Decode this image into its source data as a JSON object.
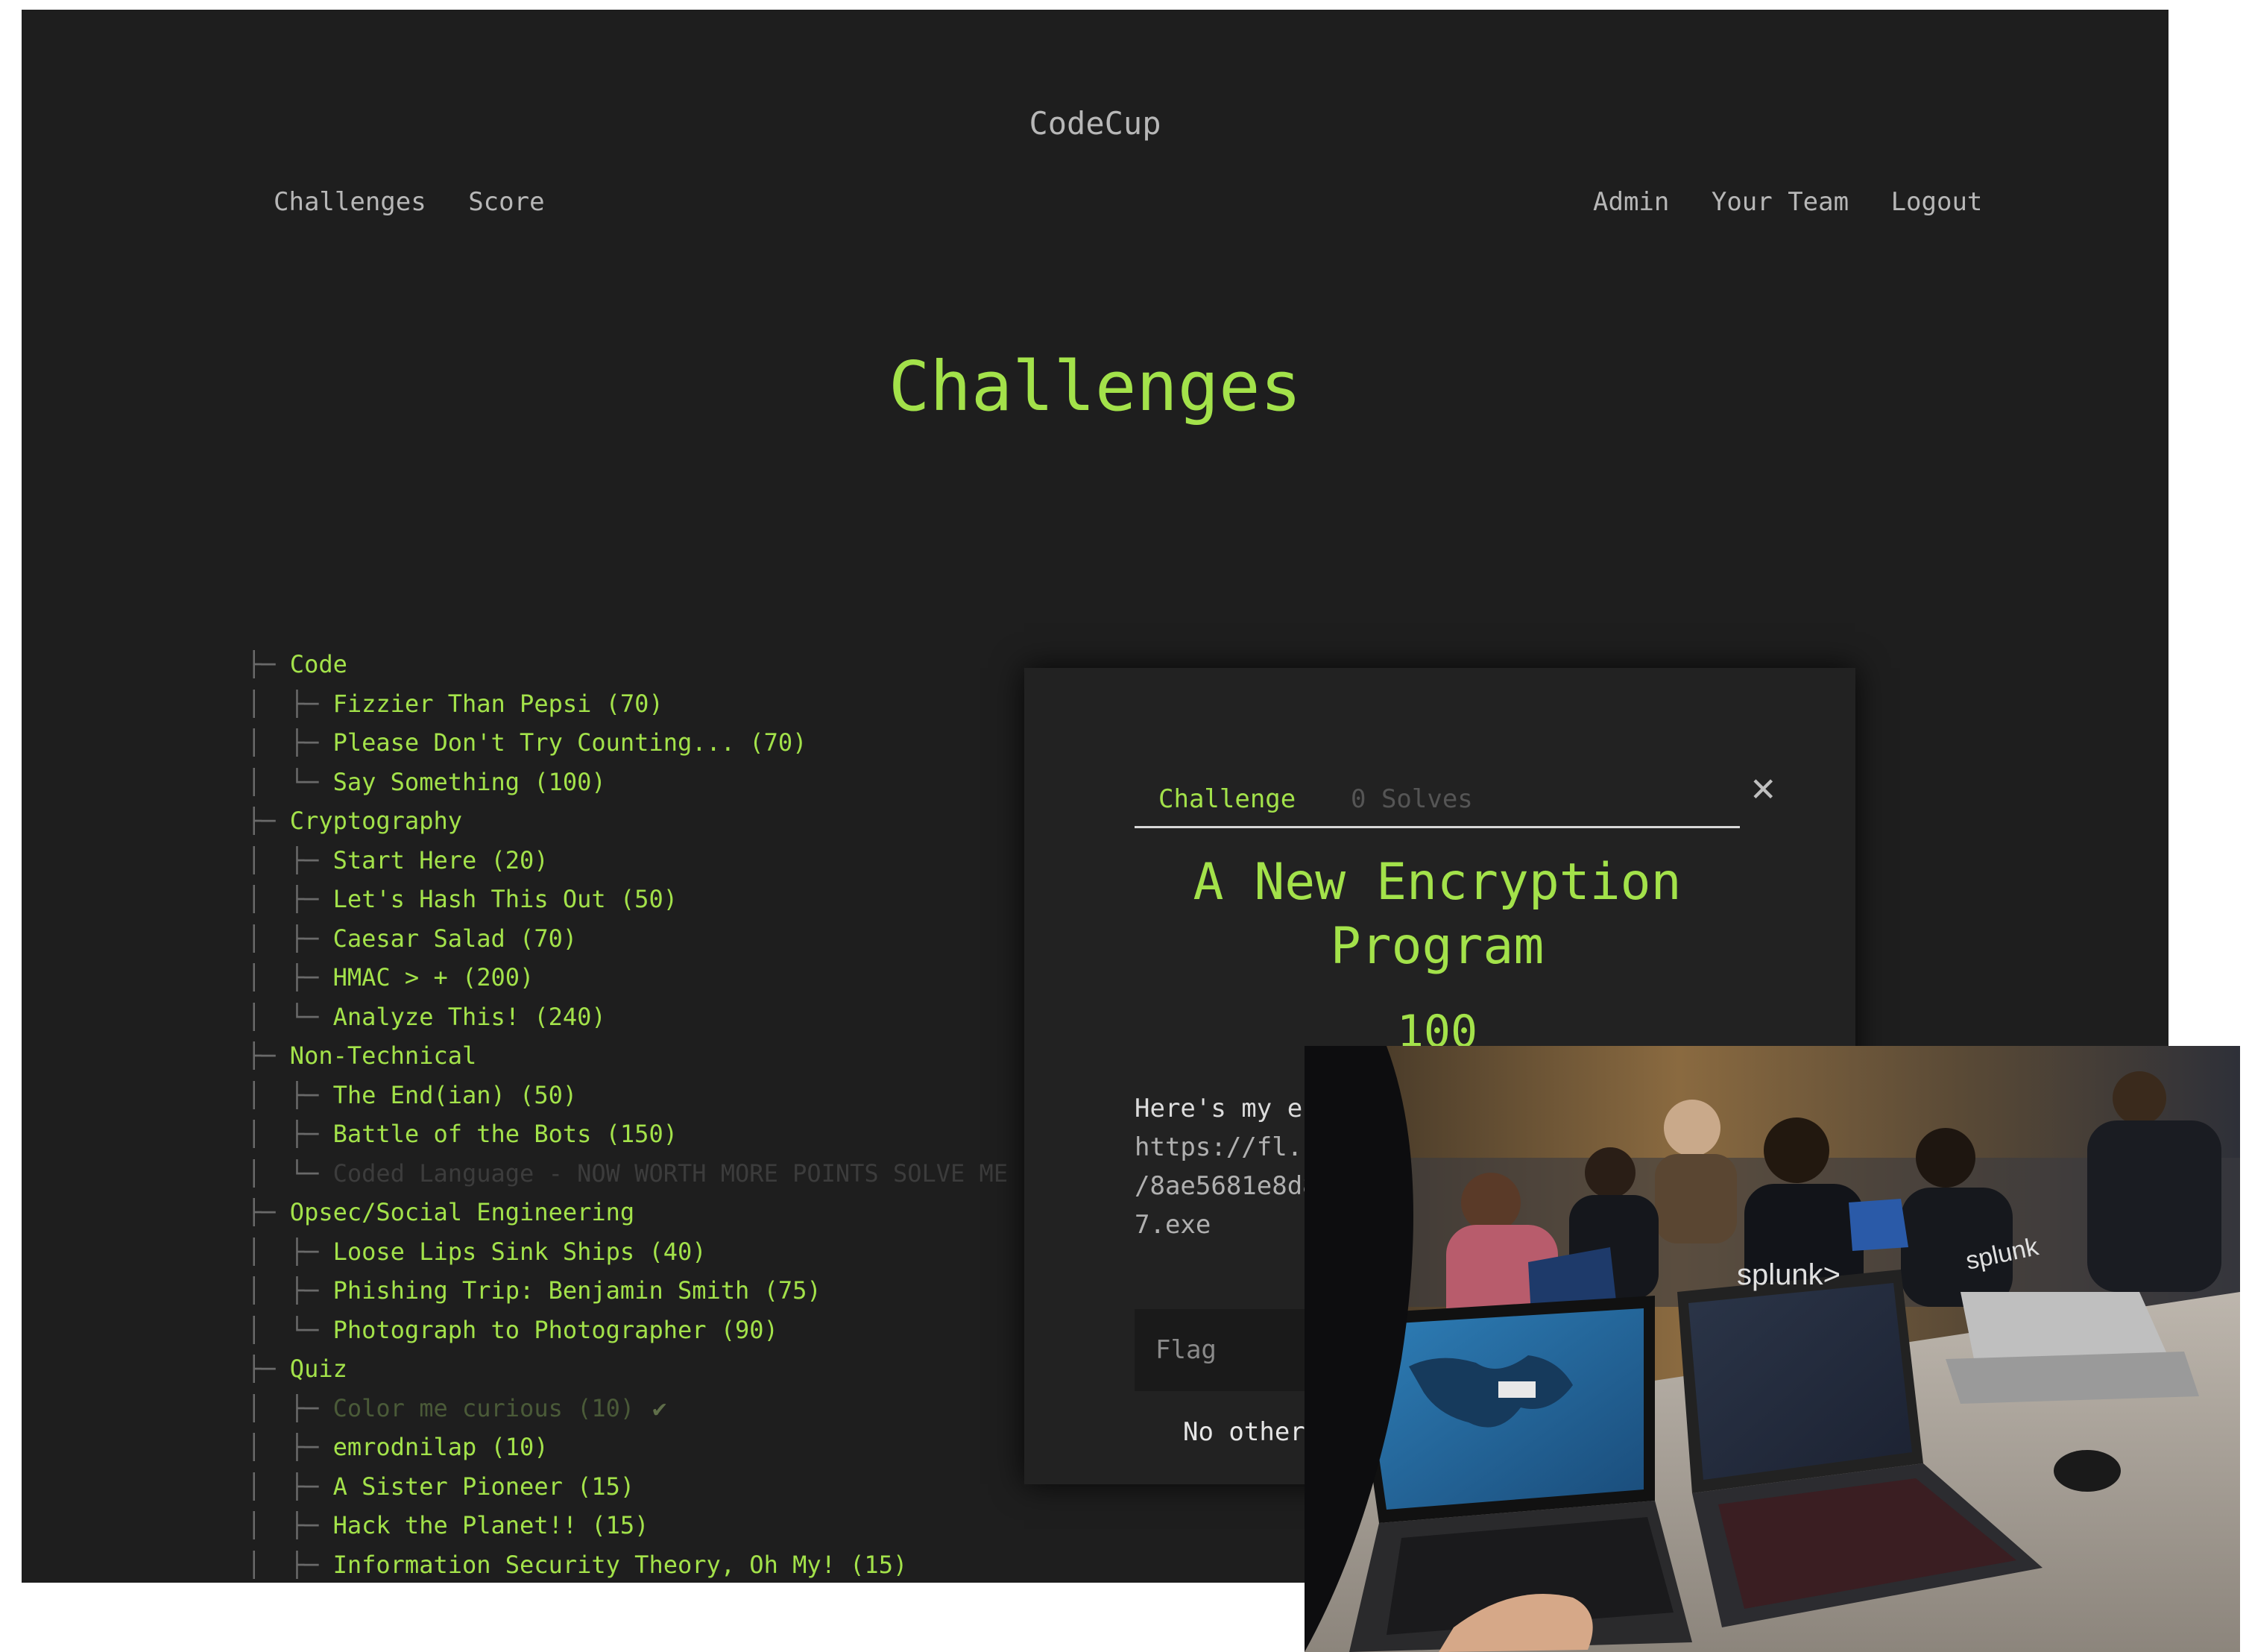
{
  "brand": "CodeCup",
  "nav": {
    "left": [
      "Challenges",
      "Score"
    ],
    "right": [
      "Admin",
      "Your Team",
      "Logout"
    ]
  },
  "page_title": "Challenges",
  "tree": [
    {
      "label": "Code",
      "depth": 0,
      "last": false,
      "state": "normal"
    },
    {
      "label": "Fizzier Than Pepsi (70)",
      "depth": 1,
      "last": false,
      "state": "normal"
    },
    {
      "label": "Please Don't Try Counting... (70)",
      "depth": 1,
      "last": false,
      "state": "normal"
    },
    {
      "label": "Say Something (100)",
      "depth": 1,
      "last": true,
      "state": "normal"
    },
    {
      "label": "Cryptography",
      "depth": 0,
      "last": false,
      "state": "normal"
    },
    {
      "label": "Start Here (20)",
      "depth": 1,
      "last": false,
      "state": "normal"
    },
    {
      "label": "Let's Hash This Out (50)",
      "depth": 1,
      "last": false,
      "state": "normal"
    },
    {
      "label": "Caesar Salad (70)",
      "depth": 1,
      "last": false,
      "state": "normal"
    },
    {
      "label": "HMAC > + (200)",
      "depth": 1,
      "last": false,
      "state": "normal"
    },
    {
      "label": "Analyze This! (240)",
      "depth": 1,
      "last": true,
      "state": "normal"
    },
    {
      "label": "Non-Technical",
      "depth": 0,
      "last": false,
      "state": "normal"
    },
    {
      "label": "The End(ian) (50)",
      "depth": 1,
      "last": false,
      "state": "normal"
    },
    {
      "label": "Battle of the Bots (150)",
      "depth": 1,
      "last": false,
      "state": "normal"
    },
    {
      "label": "Coded Language - NOW WORTH MORE POINTS SOLVE ME",
      "depth": 1,
      "last": true,
      "state": "dimmed"
    },
    {
      "label": "Opsec/Social Engineering",
      "depth": 0,
      "last": false,
      "state": "normal"
    },
    {
      "label": "Loose Lips Sink Ships (40)",
      "depth": 1,
      "last": false,
      "state": "normal"
    },
    {
      "label": "Phishing Trip: Benjamin Smith (75)",
      "depth": 1,
      "last": false,
      "state": "normal"
    },
    {
      "label": "Photograph to Photographer (90)",
      "depth": 1,
      "last": true,
      "state": "normal"
    },
    {
      "label": "Quiz",
      "depth": 0,
      "last": false,
      "state": "normal"
    },
    {
      "label": "Color me curious (10)",
      "depth": 1,
      "last": false,
      "state": "solved"
    },
    {
      "label": "emrodnilap (10)",
      "depth": 1,
      "last": false,
      "state": "normal"
    },
    {
      "label": "A Sister Pioneer (15)",
      "depth": 1,
      "last": false,
      "state": "normal"
    },
    {
      "label": "Hack the Planet!! (15)",
      "depth": 1,
      "last": false,
      "state": "normal"
    },
    {
      "label": "Information Security Theory, Oh My! (15)",
      "depth": 1,
      "last": false,
      "state": "normal"
    }
  ],
  "modal": {
    "tab_challenge": "Challenge",
    "tab_solves": "0 Solves",
    "close": "✕",
    "name_line1": "A New Encryption",
    "name_line2": "Program",
    "value": "100",
    "desc_line1": "Here's my en",
    "desc_line2": "https://fl.s",
    "desc_line3": "/8ae5681e8d8",
    "desc_line4": "7.exe",
    "flag_placeholder": "Flag",
    "no_other": "No other "
  },
  "photo": {
    "caption_icon": "classroom-photo",
    "shirt_text_1": "splunk>",
    "shirt_text_2": "splunk"
  },
  "colors": {
    "accent": "#a3e24a",
    "background": "#1e1e1e",
    "nav_text": "#b7b7b7"
  }
}
